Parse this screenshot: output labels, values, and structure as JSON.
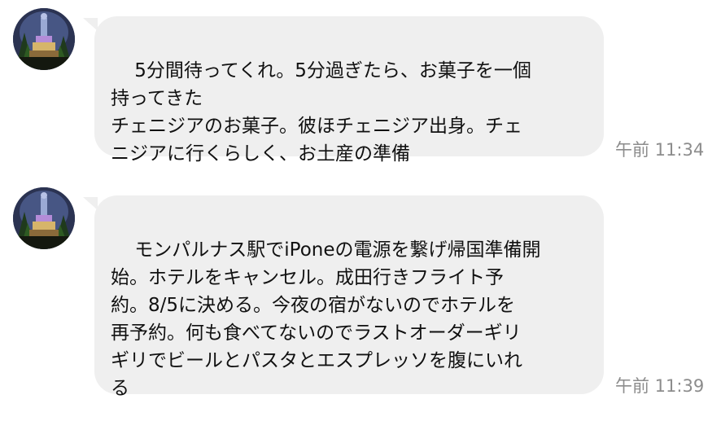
{
  "colors": {
    "bubble_bg": "#efefef",
    "text": "#111111",
    "timestamp": "#8c8c8c",
    "background": "#ffffff"
  },
  "messages": [
    {
      "avatar_icon": "statue-night-avatar",
      "text": "5分間待ってくれ。5分過ぎたら、お菓子を一個\n持ってきた\nチェニジアのお菓子。彼ほチェニジア出身。チェ\nニジアに行くらしく、お土産の準備",
      "time": "午前 11:34"
    },
    {
      "avatar_icon": "statue-night-avatar",
      "text": "モンパルナス駅でiPoneの電源を繋げ帰国準備開\n始。ホテルをキャンセル。成田行きフライト予\n約。8/5に決める。今夜の宿がないのでホテルを\n再予約。何も食べてないのでラストオーダーギリ\nギリでビールとパスタとエスプレッソを腹にいれ\nる",
      "time": "午前 11:39"
    }
  ]
}
